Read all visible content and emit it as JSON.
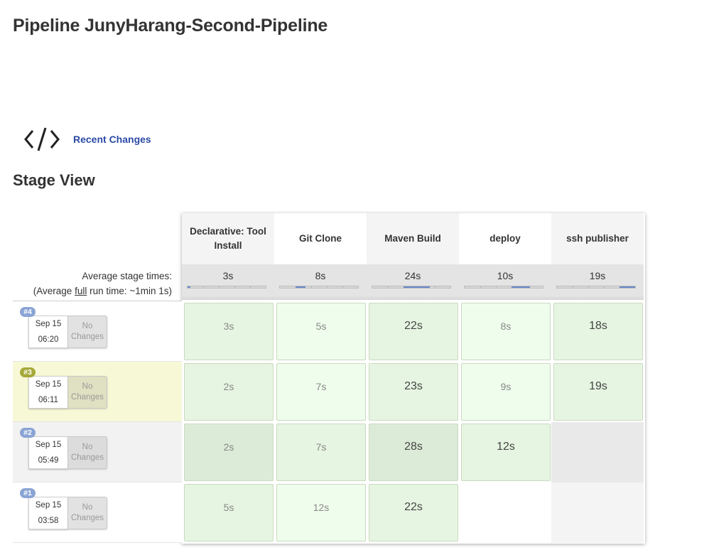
{
  "page": {
    "title": "Pipeline JunyHarang-Second-Pipeline"
  },
  "recent_changes": {
    "label": "Recent Changes",
    "icon": "code-icon"
  },
  "stage_view": {
    "title": "Stage View",
    "stages": [
      "Declarative: Tool Install",
      "Git Clone",
      "Maven Build",
      "deploy",
      "ssh publisher"
    ],
    "average": {
      "label_line1": "Average stage times:",
      "label_prefix": "(Average ",
      "label_full": "full",
      "label_suffix": " run time: ~1min 1s)",
      "times": [
        "3s",
        "8s",
        "24s",
        "10s",
        "19s"
      ],
      "bar_fraction_start": [
        0.0,
        0.2,
        0.4,
        0.6,
        0.8
      ],
      "bar_fraction_end": [
        0.04,
        0.33,
        0.74,
        0.84,
        1.0
      ]
    },
    "builds": [
      {
        "number": "#4",
        "date": "Sep 15",
        "time": "06:20",
        "changes": "No Changes",
        "badge_color": "#8aa4d4",
        "stage_times": [
          "3s",
          "5s",
          "22s",
          "8s",
          "18s"
        ]
      },
      {
        "number": "#3",
        "date": "Sep 15",
        "time": "06:11",
        "changes": "No Changes",
        "badge_color": "#a6a83a",
        "stage_times": [
          "2s",
          "7s",
          "23s",
          "9s",
          "19s"
        ]
      },
      {
        "number": "#2",
        "date": "Sep 15",
        "time": "05:49",
        "changes": "No Changes",
        "badge_color": "#8aa4d4",
        "stage_times": [
          "2s",
          "7s",
          "28s",
          "12s",
          ""
        ]
      },
      {
        "number": "#1",
        "date": "Sep 15",
        "time": "03:58",
        "changes": "No Changes",
        "badge_color": "#8aa4d4",
        "stage_times": [
          "5s",
          "12s",
          "22s",
          "",
          ""
        ]
      }
    ]
  }
}
